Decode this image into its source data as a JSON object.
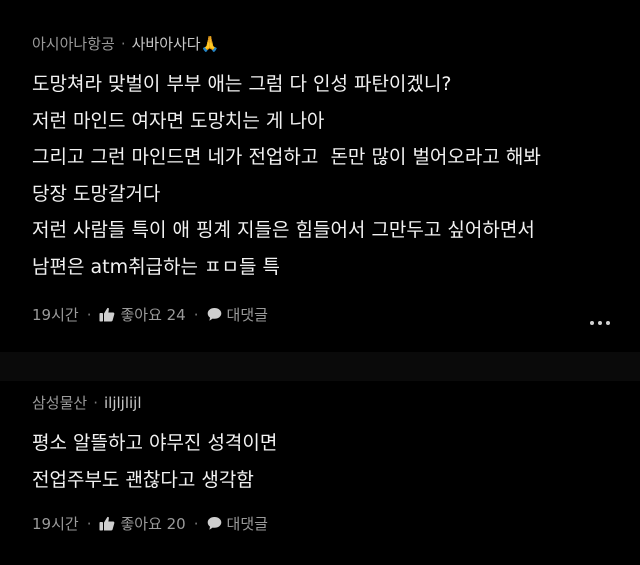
{
  "comments": [
    {
      "author": "아시아나항공",
      "username": "사바아사다🙏",
      "lines": [
        "도망쳐라 맞벌이 부부 애는 그럼 다 인성 파탄이겠니?",
        "저런 마인드 여자면 도망치는 게 나아",
        "그리고 그런 마인드면 네가 전업하고  돈만 많이 벌어오라고 해봐",
        "당장 도망갈거다",
        "저런 사람들 특이 애 핑계 지들은 힘들어서 그만두고 싶어하면서",
        "남편은 atm취급하는 ㅍㅁ들 특"
      ],
      "time": "19시간",
      "like_label": "좋아요 24",
      "reply_label": "대댓글"
    },
    {
      "author": "삼성물산",
      "username": "iljljlijl",
      "lines": [
        "평소 알뜰하고 야무진 성격이면",
        "전업주부도 괜찮다고 생각함"
      ],
      "time": "19시간",
      "like_label": "좋아요 20",
      "reply_label": "대댓글"
    }
  ],
  "colors": {
    "background": "#000000",
    "divider": "#0a0a0a",
    "meta_text": "#9a9a9a",
    "body_text": "#f2f2f2"
  },
  "icons": [
    "thumbs-up-icon",
    "speech-bubble-icon",
    "more-dots-icon"
  ]
}
